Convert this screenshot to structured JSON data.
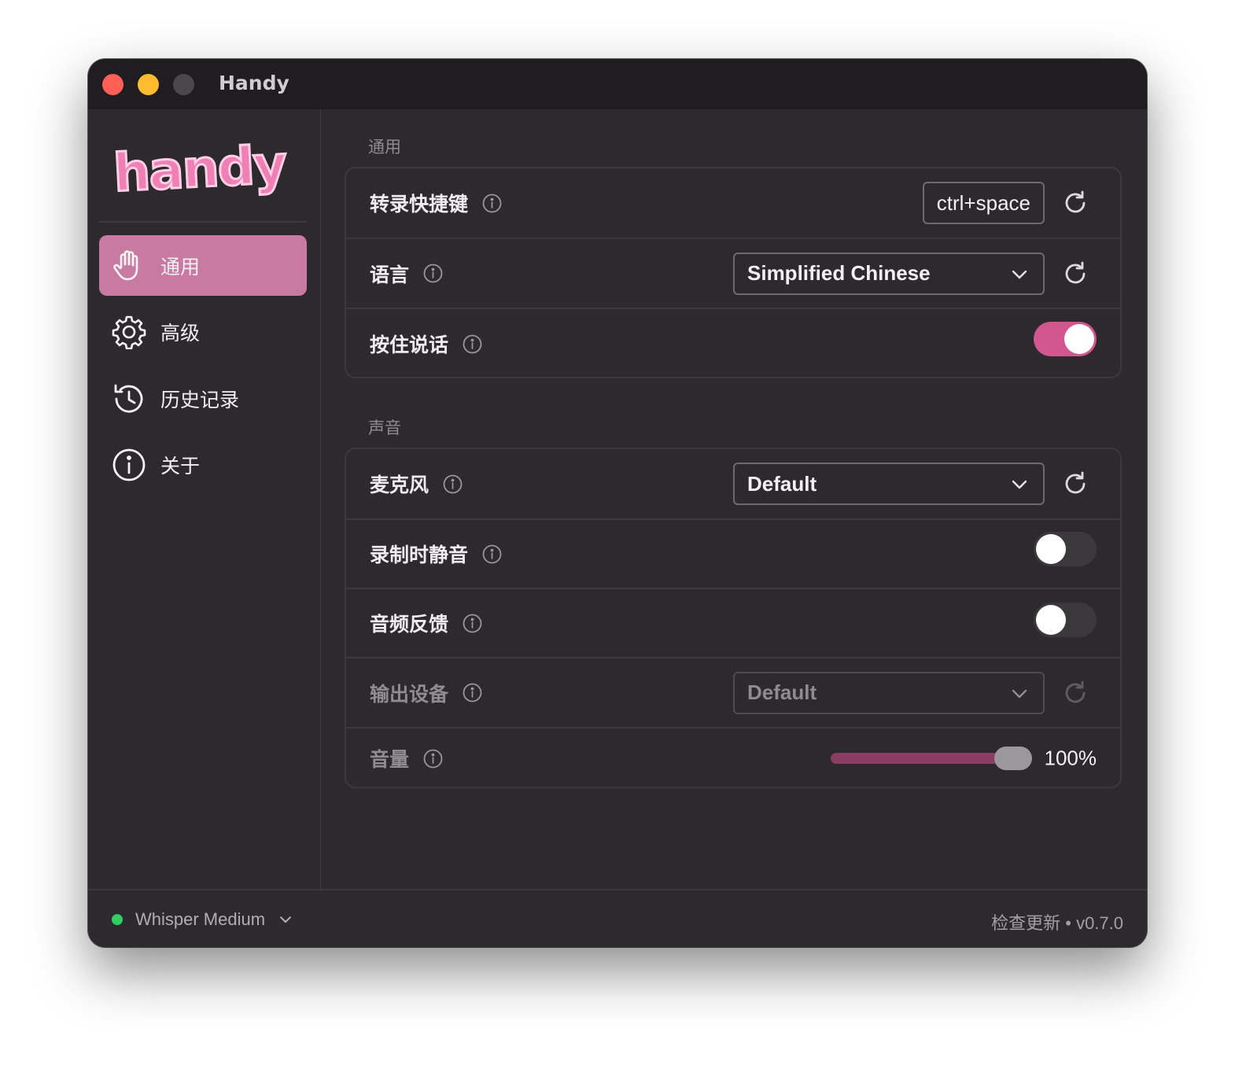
{
  "window": {
    "title": "Handy"
  },
  "sidebar": {
    "logo_text": "handy",
    "items": [
      {
        "label": "通用",
        "icon": "hand-icon",
        "active": true
      },
      {
        "label": "高级",
        "icon": "gear-icon",
        "active": false
      },
      {
        "label": "历史记录",
        "icon": "history-icon",
        "active": false
      },
      {
        "label": "关于",
        "icon": "info-circle-icon",
        "active": false
      }
    ]
  },
  "sections": {
    "general": {
      "title": "通用",
      "shortcut": {
        "label": "转录快捷键",
        "value": "ctrl+space"
      },
      "language": {
        "label": "语言",
        "value": "Simplified Chinese"
      },
      "push_to_talk": {
        "label": "按住说话",
        "enabled": true
      }
    },
    "sound": {
      "title": "声音",
      "microphone": {
        "label": "麦克风",
        "value": "Default"
      },
      "mute_while_recording": {
        "label": "录制时静音",
        "enabled": false
      },
      "audio_feedback": {
        "label": "音频反馈",
        "enabled": false
      },
      "output_device": {
        "label": "输出设备",
        "value": "Default",
        "disabled": true
      },
      "volume": {
        "label": "音量",
        "value": 100,
        "display": "100%"
      }
    }
  },
  "footer": {
    "model": "Whisper Medium",
    "model_status_color": "#2fcf64",
    "update_text": "检查更新 • v0.7.0"
  },
  "colors": {
    "accent": "#d2568f",
    "active_nav": "#c97aa2",
    "logo": "#f07fb5"
  }
}
